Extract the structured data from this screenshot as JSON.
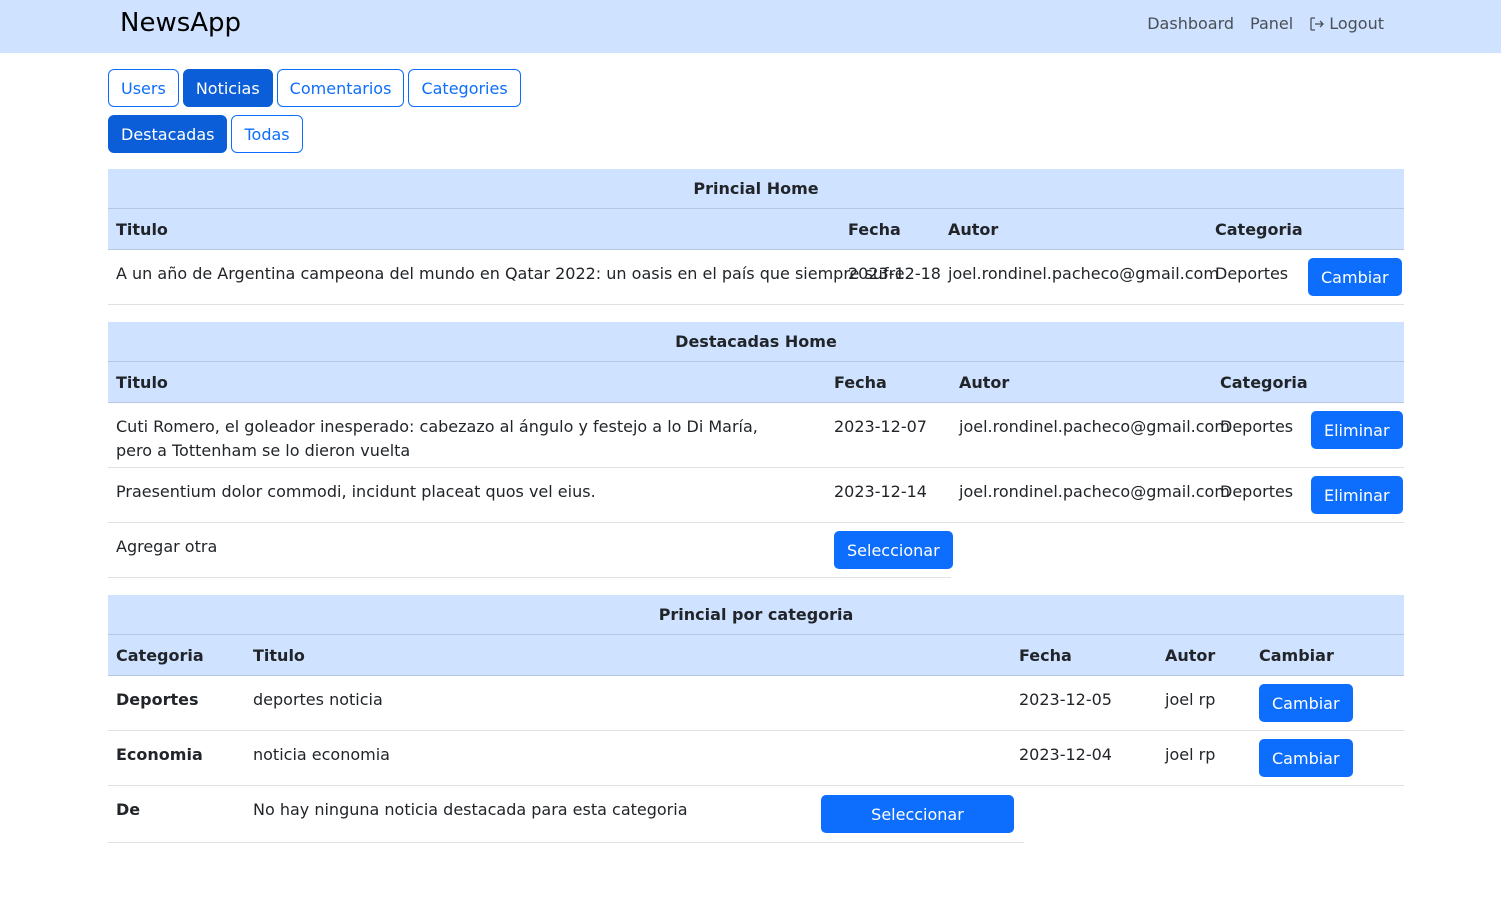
{
  "navbar": {
    "brand": "NewsApp",
    "links": [
      "Dashboard",
      "Panel",
      "Logout"
    ]
  },
  "tabs_main": [
    "Users",
    "Noticias",
    "Comentarios",
    "Categories"
  ],
  "tabs_sub": [
    "Destacadas",
    "Todas"
  ],
  "principal_home": {
    "title": "Princial Home",
    "headers": [
      "Titulo",
      "Fecha",
      "Autor",
      "Categoria"
    ],
    "row": {
      "titulo": "A un año de Argentina campeona del mundo en Qatar 2022: un oasis en el país que siempre sufre",
      "fecha": "2023-12-18",
      "autor": "joel.rondinel.pacheco@gmail.com",
      "categoria": "Deportes",
      "button": "Cambiar"
    }
  },
  "destacadas_home": {
    "title": "Destacadas Home",
    "headers": [
      "Titulo",
      "Fecha",
      "Autor",
      "Categoria"
    ],
    "rows": [
      {
        "titulo": "Cuti Romero, el goleador inesperado: cabezazo al ángulo y festejo a lo Di María, pero a Tottenham se lo dieron vuelta",
        "fecha": "2023-12-07",
        "autor": "joel.rondinel.pacheco@gmail.com",
        "categoria": "Deportes",
        "button": "Eliminar"
      },
      {
        "titulo": "Praesentium dolor commodi, incidunt placeat quos vel eius.",
        "fecha": "2023-12-14",
        "autor": "joel.rondinel.pacheco@gmail.com",
        "categoria": "Deportes",
        "button": "Eliminar"
      }
    ],
    "add_label": "Agregar otra",
    "add_button": "Seleccionar"
  },
  "principal_categoria": {
    "title": "Princial por categoria",
    "headers": [
      "Categoria",
      "Titulo",
      "Fecha",
      "Autor",
      "Cambiar"
    ],
    "rows": [
      {
        "categoria": "Deportes",
        "titulo": "deportes noticia",
        "fecha": "2023-12-05",
        "autor": "joel rp",
        "button": "Cambiar"
      },
      {
        "categoria": "Economia",
        "titulo": "noticia economia",
        "fecha": "2023-12-04",
        "autor": "joel rp",
        "button": "Cambiar"
      }
    ],
    "empty_row": {
      "categoria": "De",
      "message": "No hay ninguna noticia destacada para esta categoria",
      "button": "Seleccionar"
    }
  },
  "colors": {
    "primary": "#0d6efd",
    "header_bg": "#cfe2ff"
  },
  "icons": {
    "logout": "logout-icon"
  }
}
